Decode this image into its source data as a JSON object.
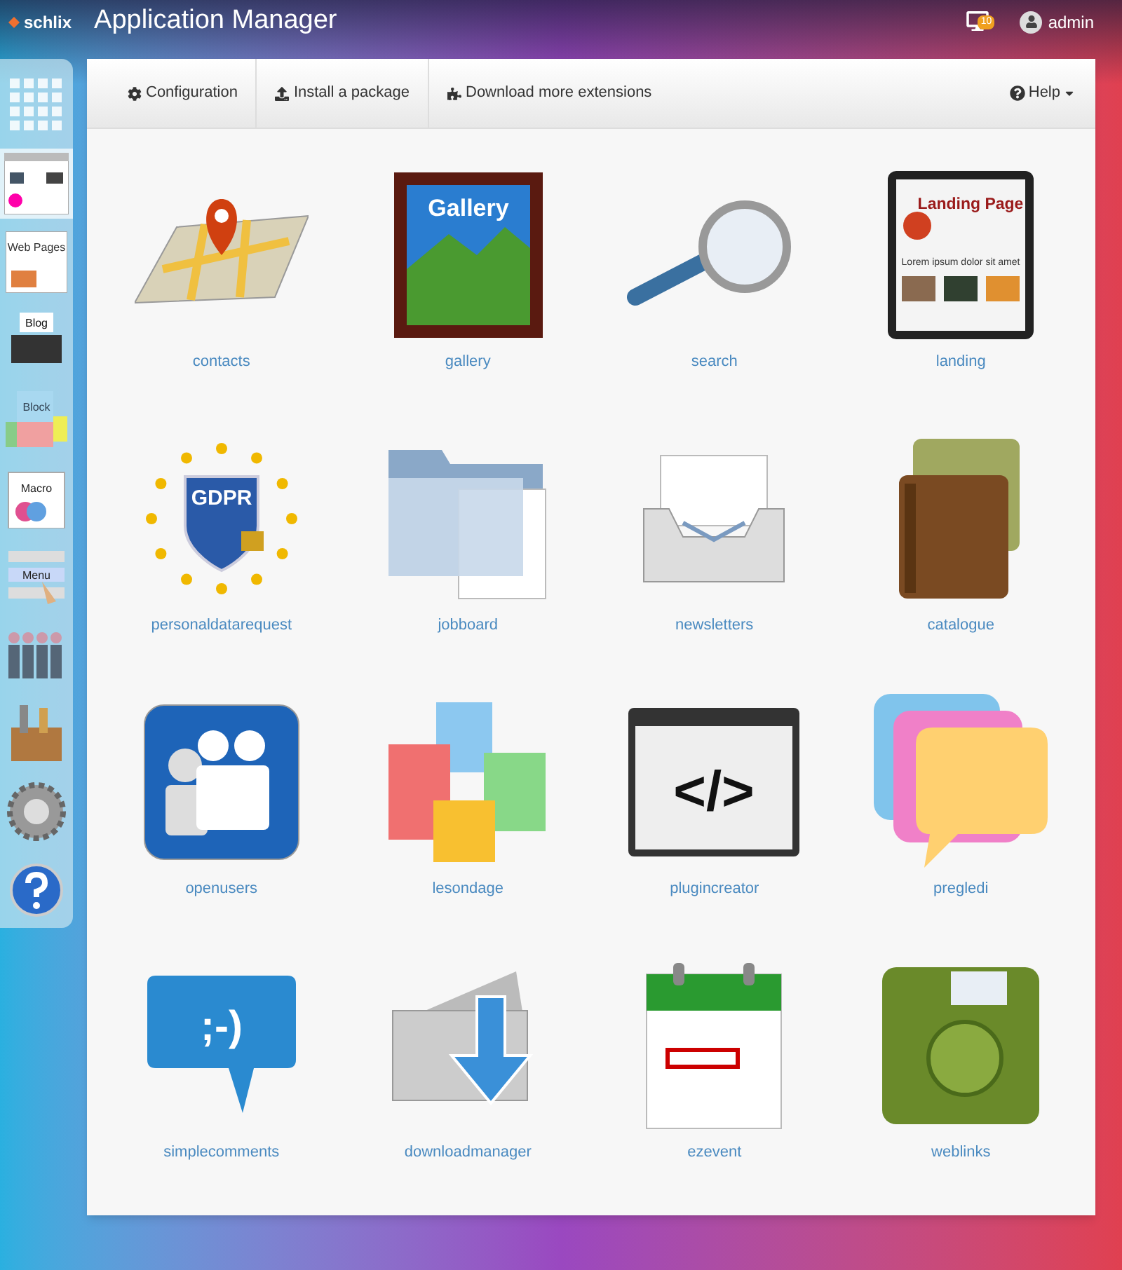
{
  "header": {
    "logo": "schlix",
    "title": "Application Manager",
    "notifications_badge": "10",
    "user": "admin"
  },
  "sidebar": {
    "items": [
      {
        "kind": "grid",
        "selected": false
      },
      {
        "kind": "webapps",
        "selected": true
      },
      {
        "kind": "webpages",
        "label": "Web Pages",
        "selected": false
      },
      {
        "kind": "blog",
        "label": "Blog",
        "selected": false
      },
      {
        "kind": "block",
        "label": "Block",
        "selected": false
      },
      {
        "kind": "macro",
        "label": "Macro",
        "selected": false
      },
      {
        "kind": "menu",
        "label": "Menu",
        "selected": false
      },
      {
        "kind": "people",
        "selected": false
      },
      {
        "kind": "toolbox",
        "selected": false
      },
      {
        "kind": "gear",
        "selected": false
      },
      {
        "kind": "help",
        "selected": false
      }
    ]
  },
  "toolbar": {
    "items": [
      {
        "kind": "gear",
        "label": "Configuration"
      },
      {
        "kind": "upload",
        "label": "Install a package"
      },
      {
        "kind": "puzzle",
        "label": "Download more extensions"
      }
    ],
    "help": "Help"
  },
  "apps": [
    {
      "kind": "map",
      "name": "contacts"
    },
    {
      "kind": "gallery",
      "name": "gallery",
      "icon_text": "Gallery"
    },
    {
      "kind": "magnifier",
      "name": "search"
    },
    {
      "kind": "tablet",
      "name": "landing",
      "icon_text": "Landing Page",
      "icon_subtext": "Lorem ipsum dolor sit amet"
    },
    {
      "kind": "gdpr",
      "name": "personaldatarequest",
      "icon_text": "GDPR"
    },
    {
      "kind": "folder",
      "name": "jobboard"
    },
    {
      "kind": "inbox",
      "name": "newsletters"
    },
    {
      "kind": "books",
      "name": "catalogue"
    },
    {
      "kind": "users",
      "name": "openusers"
    },
    {
      "kind": "cubes",
      "name": "lesondage"
    },
    {
      "kind": "code",
      "name": "plugincreator",
      "icon_text": "</>"
    },
    {
      "kind": "chats",
      "name": "pregledi"
    },
    {
      "kind": "comment",
      "name": "simplecomments",
      "icon_text": ";-)"
    },
    {
      "kind": "download",
      "name": "downloadmanager"
    },
    {
      "kind": "calendar",
      "name": "ezevent"
    },
    {
      "kind": "greenbook",
      "name": "weblinks"
    }
  ]
}
